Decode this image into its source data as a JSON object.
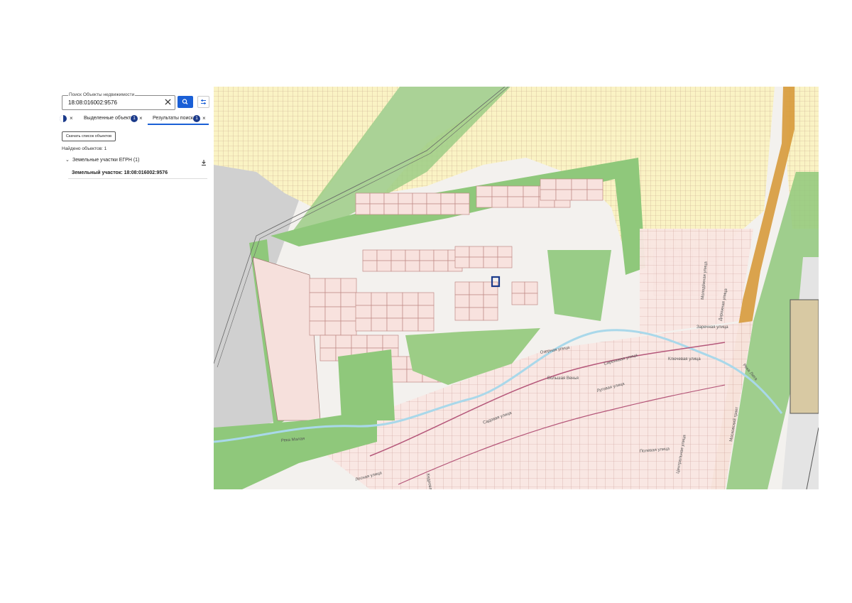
{
  "search": {
    "label": "Поиск Объекты недвижимости",
    "value": "18:08:016002:9576"
  },
  "tabs": [
    {
      "label": "Выделенные объекты",
      "count": "1"
    },
    {
      "label": "Результаты поиска",
      "count": "1"
    }
  ],
  "download_button": "Скачать список объектов",
  "found_text": "Найдено объектов: 1",
  "results_group": {
    "label": "Земельные участки ЕГРН (1)"
  },
  "result_item": {
    "label": "Земельный участок: 18:08:016002:9576"
  },
  "map": {
    "labels": {
      "village": "Большая Венья",
      "street_1": "Садовая улица",
      "street_2": "Луговая улица",
      "street_3": "Полевая улица",
      "street_4": "Лесная улица",
      "street_5": "Ключевая улица",
      "street_6": "Сиреневая улица",
      "street_7": "Кедровая улица",
      "street_8": "Центральная улица",
      "street_9": "Озерная улица",
      "river_1": "Река Малая",
      "river_2": "Река Люга",
      "road": "Московский тракт",
      "street_10": "Заречная улица",
      "street_11": "Молодёжная улица",
      "street_12": "Дорожная улица"
    },
    "colors": {
      "parcel_fill": "#f8e2de",
      "parcel_stroke": "#c08a86",
      "yellow_zone": "#faf3c4",
      "yellow_zone_grid": "#c9a98d",
      "green_zone": "#8fc87b",
      "water": "#a9d8ea",
      "highway": "#d79a3b",
      "selected_parcel": "#1b3a8a",
      "gray_zone": "#cfcfcf"
    }
  }
}
